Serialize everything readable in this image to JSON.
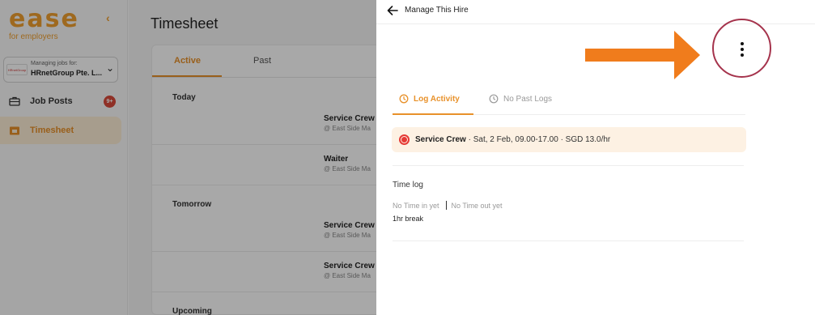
{
  "sidebar": {
    "logo": "ease",
    "logo_sub": "for employers",
    "company_label": "Managing jobs for:",
    "company_name": "HRnetGroup Pte. L...",
    "company_logo_text": "HRnetGroup",
    "items": [
      {
        "label": "Job Posts",
        "icon": "briefcase-icon",
        "badge": "9+"
      },
      {
        "label": "Timesheet",
        "icon": "calendar-icon",
        "active": true
      }
    ]
  },
  "main": {
    "title": "Timesheet",
    "tabs": [
      {
        "label": "Active",
        "active": true
      },
      {
        "label": "Past"
      }
    ],
    "groups": [
      {
        "label": "Today"
      },
      {
        "label": "Tomorrow"
      },
      {
        "label": "Upcoming"
      }
    ],
    "rows": [
      {
        "role": "Service Crew",
        "location": "@ East Side Ma"
      },
      {
        "role": "Waiter",
        "location": "@ East Side Ma"
      },
      {
        "role": "Service Crew",
        "location": "@ East Side Ma"
      },
      {
        "role": "Service Crew",
        "location": "@ East Side Ma"
      }
    ]
  },
  "drawer": {
    "title": "Manage This Hire",
    "tabs": [
      {
        "label": "Log Activity",
        "icon": "clock-icon",
        "active": true
      },
      {
        "label": "No Past Logs",
        "icon": "history-icon"
      }
    ],
    "shift": {
      "role": "Service Crew",
      "detail": " · Sat, 2 Feb, 09.00-17.00 · SGD 13.0/hr",
      "status_color": "#e53935"
    },
    "time_log": {
      "title": "Time log",
      "time_in": "No Time in yet",
      "time_out": "No Time out yet",
      "break": "1hr break"
    }
  },
  "colors": {
    "accent": "#e8912a",
    "pointer_arrow": "#f07c1c",
    "highlight_ring": "#a5334c",
    "status_red": "#e53935"
  }
}
